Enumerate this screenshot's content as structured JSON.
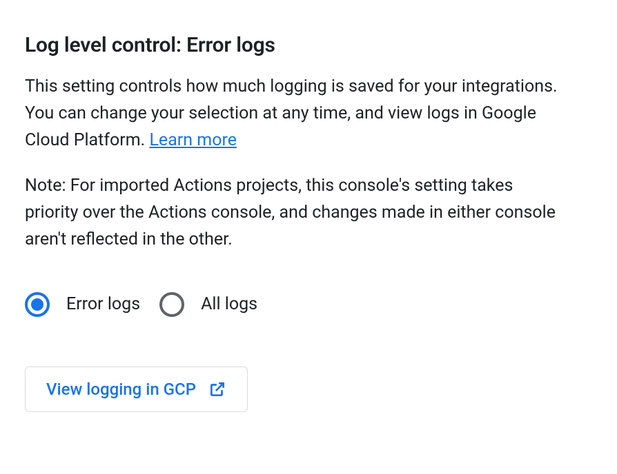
{
  "heading": "Log level control: Error logs",
  "description": {
    "para1_part1": "This setting controls how much logging is saved for your integrations. You can change your selection at any time, and view logs in Google Cloud Platform. ",
    "learn_more": "Learn more",
    "para2": "Note: For imported Actions projects, this console's setting takes priority over the Actions console, and changes made in either console aren't reflected in the other."
  },
  "radio_options": {
    "error_logs": "Error logs",
    "all_logs": "All logs"
  },
  "buttons": {
    "view_logging": "View logging in GCP"
  },
  "colors": {
    "primary": "#1a73e8",
    "text": "#202124",
    "border": "#dadce0",
    "radio_unselected": "#5f6368"
  }
}
